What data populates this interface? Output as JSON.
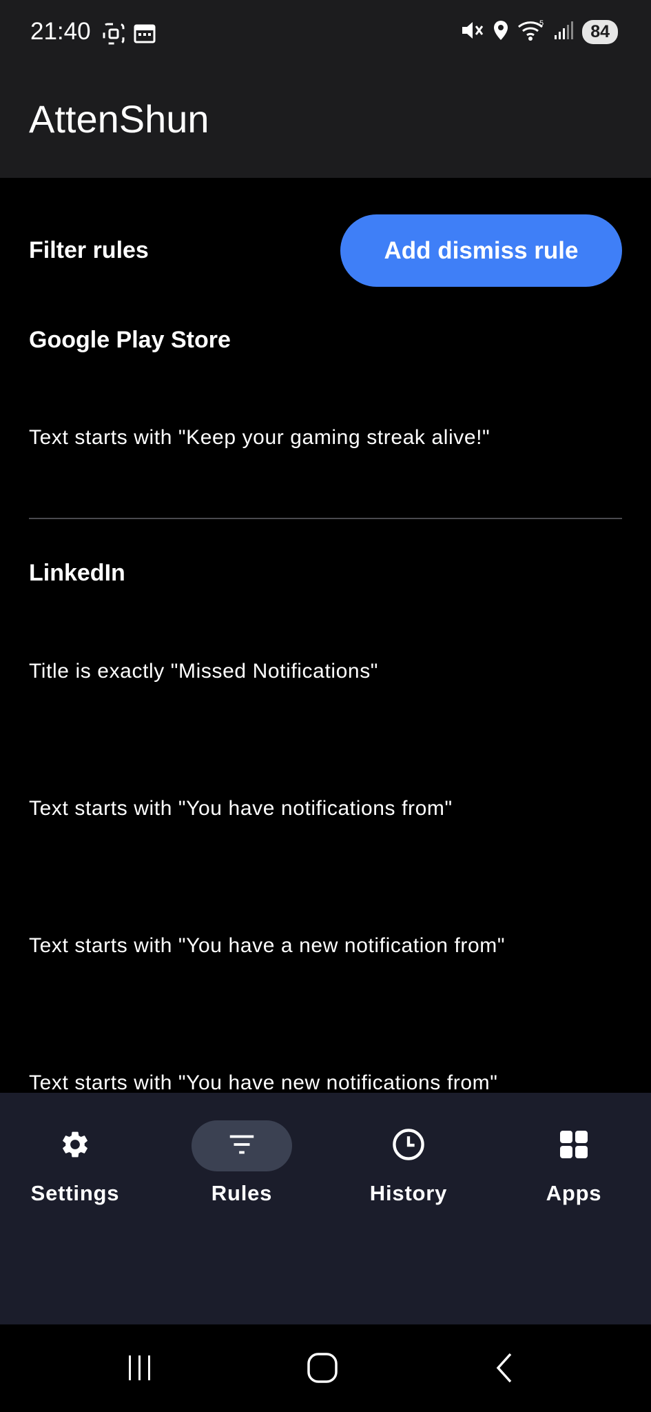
{
  "status_bar": {
    "time": "21:40",
    "left_icons": [
      "screenshot-icon",
      "calendar-icon"
    ],
    "right_icons": [
      "mute-icon",
      "location-icon",
      "wifi-icon",
      "signal-icon"
    ],
    "battery": "84"
  },
  "app_bar": {
    "title": "AttenShun"
  },
  "filter": {
    "header": "Filter rules",
    "add_button_label": "Add dismiss rule"
  },
  "groups": [
    {
      "app_name": "Google Play Store",
      "rules": [
        "Text starts with \"Keep your gaming streak alive!\""
      ]
    },
    {
      "app_name": "LinkedIn",
      "rules": [
        "Title is exactly \"Missed Notifications\"",
        "Text starts with \"You have notifications from\"",
        "Text starts with \"You have a new notification from\"",
        "Text starts with \"You have new notifications from\""
      ]
    }
  ],
  "bottom_nav": {
    "items": [
      {
        "label": "Settings",
        "icon": "gear-icon",
        "active": false
      },
      {
        "label": "Rules",
        "icon": "filter-icon",
        "active": true
      },
      {
        "label": "History",
        "icon": "clock-icon",
        "active": false
      },
      {
        "label": "Apps",
        "icon": "apps-grid-icon",
        "active": false
      }
    ]
  },
  "colors": {
    "accent": "#3f7ff7",
    "app_bar_bg": "#1c1c1e",
    "nav_bg": "#1b1d2b",
    "active_pill": "#3b4152"
  }
}
